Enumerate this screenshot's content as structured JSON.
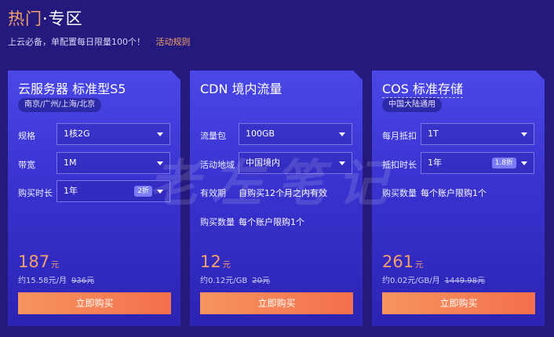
{
  "header": {
    "title_hot": "热门",
    "title_rest": "·专区",
    "subtitle": "上云必备，单配置每日限量100个！",
    "rules_link": "活动规则"
  },
  "cards": [
    {
      "title": "云服务器 标准型S5",
      "tag": "南京/广州/上海/北京",
      "rows": [
        {
          "label": "规格",
          "value": "1核2G"
        },
        {
          "label": "带宽",
          "value": "1M"
        },
        {
          "label": "购买时长",
          "value": "1年",
          "badge": "2折"
        }
      ],
      "price": "187",
      "price_unit": "元",
      "per": "约15.58元/月",
      "original": "936元",
      "buy": "立即购买"
    },
    {
      "title": "CDN 境内流量",
      "rows": [
        {
          "label": "流量包",
          "value": "100GB"
        },
        {
          "label": "活动地域",
          "value": "中国境内"
        }
      ],
      "validity_label": "有效期",
      "validity_text": "自购买12个月之内有效",
      "limit_label": "购买数量",
      "limit_text": "每个账户限购1个",
      "price": "12",
      "price_unit": "元",
      "per": "约0.12元/GB",
      "original": "20元",
      "buy": "立即购买"
    },
    {
      "title": "COS 标准存储",
      "tag": "中国大陆通用",
      "rows": [
        {
          "label": "每月抵扣",
          "value": "1T"
        },
        {
          "label": "抵扣时长",
          "value": "1年",
          "badge": "1.8折"
        }
      ],
      "limit_label": "购买数量",
      "limit_text": "每个账户限购1个",
      "price": "261",
      "price_unit": "元",
      "per": "约0.02元/GB/月",
      "original": "1449.98元",
      "buy": "立即购买"
    }
  ],
  "watermark": "老左笔记",
  "colors": {
    "background": "#241a7e",
    "accent_orange": "#f5a06a",
    "button_start": "#f79460",
    "button_end": "#f46f4c"
  }
}
